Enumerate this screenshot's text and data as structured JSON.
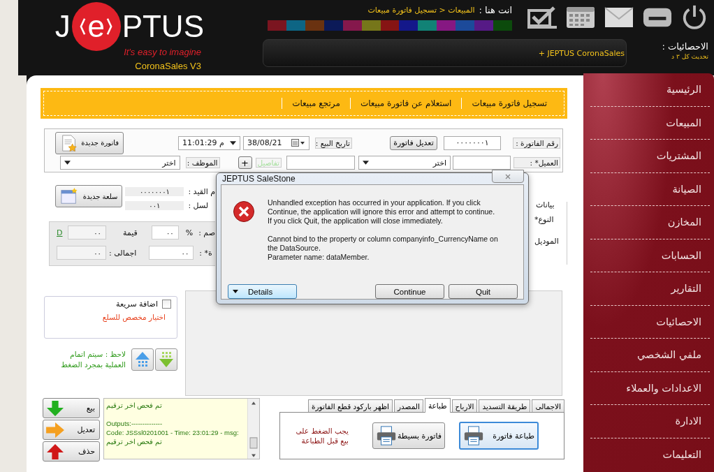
{
  "header": {
    "logo": {
      "left": "J",
      "mark": "e",
      "right": "PTUS",
      "tagline": "It's easy to imagine",
      "product": "CoronaSales V3"
    },
    "breadcrumb": {
      "label": "انت هنا :",
      "path": "المبيعات < تسجيل فاتورة مبيعات"
    },
    "theme_swatches": [
      {
        "color": "#7b1520"
      },
      {
        "color": "#0d6584"
      },
      {
        "color": "#6a3210"
      },
      {
        "color": "#0c1a58"
      },
      {
        "color": "#85184c"
      },
      {
        "color": "#76761a"
      },
      {
        "color": "#861414"
      },
      {
        "color": "#14188a"
      },
      {
        "color": "#118276"
      },
      {
        "color": "#861882"
      },
      {
        "color": "#1c4a9a"
      },
      {
        "color": "#561a86"
      },
      {
        "color": "#0c4a0c"
      }
    ],
    "stats": {
      "label": "الاحصائيات :",
      "refresh_note": "تحديث كل ٣ د",
      "ticker": "+ JEPTUS CoronaSales"
    }
  },
  "menu_bar": [
    "تسجيل فاتورة مبيعات",
    "استعلام عن فاتورة مبيعات",
    "مرتجع مبيعات"
  ],
  "invoice_form": {
    "invoice_number": {
      "label": "رقم الفاتورة :",
      "value": "٠٠٠٠٠٠٠١"
    },
    "edit_button": "تعديل فاتورة",
    "sale_date": {
      "label": "تاريخ البيع :",
      "date": "38/08/21",
      "time": "11:01:29 م"
    },
    "new_invoice_button": "فاتورة جديدة",
    "customer": {
      "label": "العميل* :",
      "select": "اختر"
    },
    "details_link": {
      "label": "تفاصيل",
      "disabled": true
    },
    "add_button": "+",
    "employee": {
      "label": "الموظف :",
      "select": "اختر"
    }
  },
  "item_panel": {
    "new_item_button": "سلعة جديدة",
    "fields": [
      {
        "label": "م القيد :",
        "value": "٠٠٠٠٠٠٠١"
      },
      {
        "label": "لسل :",
        "value": "٠٠١"
      }
    ],
    "currency_link": "D",
    "value_field": {
      "label": "قيمة",
      "value": "٠٠"
    },
    "discount": {
      "value": "٠٠",
      "unit": "%",
      "label": "صم :"
    },
    "total": {
      "label": "اجمالى :",
      "value": "٠٠"
    },
    "field_4": {
      "label": "ة* :",
      "value": "٠٠"
    },
    "details_group": {
      "legend": "بيانات",
      "labels": [
        "النوع*",
        "الموديل"
      ]
    }
  },
  "quick_add": {
    "label": "اضافة سريعة",
    "checked": false,
    "hint": "اختيار مخصص للسلع"
  },
  "note": [
    "لاحظ : سيتم اتمام",
    "العملية بمجرد الضغط"
  ],
  "actions": [
    {
      "kind": "sell",
      "label": "بيع"
    },
    {
      "kind": "edit",
      "label": "تعديل"
    },
    {
      "kind": "delete",
      "label": "حذف"
    }
  ],
  "log": [
    [
      "تم فحص اخر ترقيم"
    ],
    [
      "Outputs:--------------",
      "Code: JSSsl0201001 - Time: 23:01:29 - msg:",
      "تم فحص اخر ترقيم"
    ]
  ],
  "tabs": [
    {
      "label": "الاجمالى",
      "selected": false
    },
    {
      "label": "طريقة التسديد",
      "selected": false
    },
    {
      "label": "الارباح",
      "selected": false
    },
    {
      "label": "طباعة",
      "selected": true
    },
    {
      "label": "المصدر",
      "selected": false
    },
    {
      "label": "اظهر باركود قطع الفاتورة",
      "selected": false
    }
  ],
  "print_panel": {
    "buttons": [
      {
        "label": "طباعة فاتورة",
        "highlighted": true
      },
      {
        "label": "فاتورة بسيطة",
        "highlighted": false
      }
    ],
    "note": [
      "يجب الضغط على",
      "بيع قبل الطباعة"
    ]
  },
  "sidebar": [
    "الرئيسية",
    "المبيعات",
    "المشتريات",
    "الصيانة",
    "المخازن",
    "الحسابات",
    "التقارير",
    "الاحصائيات",
    "ملفي الشخصي",
    "الاعدادات والعملاء",
    "الادارة",
    "التعليمات"
  ],
  "dialog": {
    "title": "JEPTUS SaleStone",
    "message": [
      "Unhandled exception has occurred in your application. If you click",
      "Continue, the application will ignore this error and attempt to continue.",
      "If you click Quit, the application will close immediately."
    ],
    "details": [
      "Cannot bind to the property or column companyinfo_CurrencyName on",
      "the DataSource.",
      "Parameter name: dataMember."
    ],
    "details_button": "Details",
    "continue_button": "Continue",
    "quit_button": "Quit"
  }
}
